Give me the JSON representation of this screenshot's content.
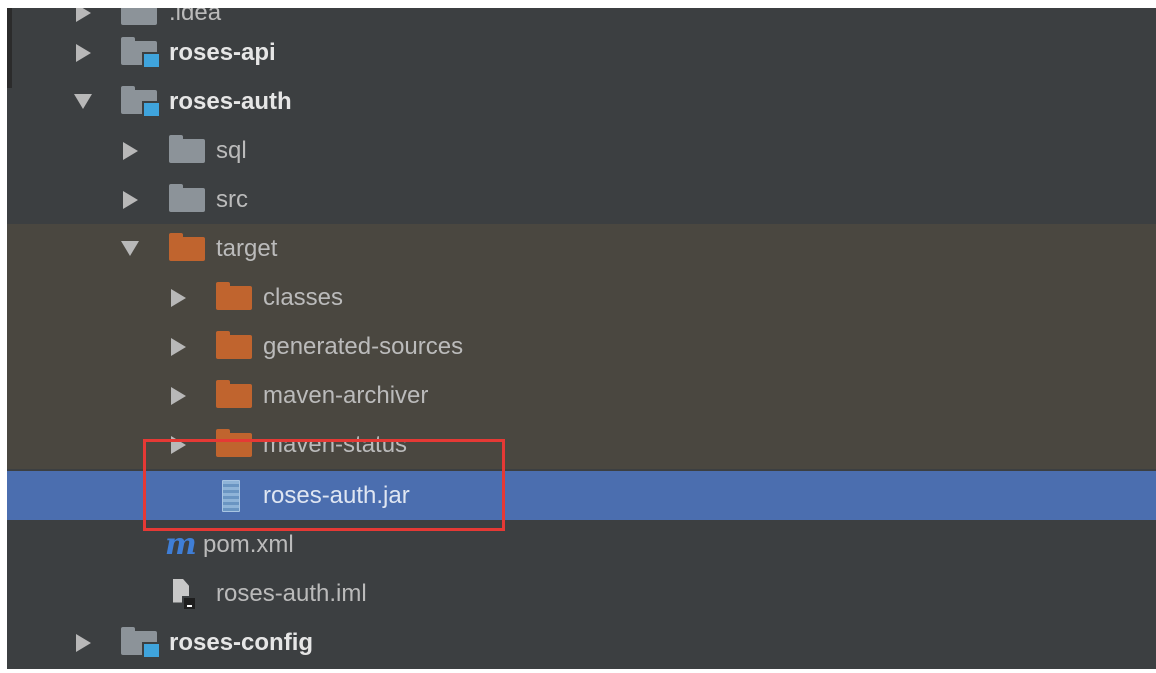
{
  "project_tree": {
    "items": [
      {
        "label": ".idea"
      },
      {
        "label": "roses-api"
      },
      {
        "label": "roses-auth"
      },
      {
        "label": "sql"
      },
      {
        "label": "src"
      },
      {
        "label": "target"
      },
      {
        "label": "classes"
      },
      {
        "label": "generated-sources"
      },
      {
        "label": "maven-archiver"
      },
      {
        "label": "maven-status"
      },
      {
        "label": "roses-auth.jar"
      },
      {
        "label": "pom.xml"
      },
      {
        "label": "roses-auth.iml"
      },
      {
        "label": "roses-config"
      }
    ]
  },
  "colors": {
    "panel_background": "#3c3f41",
    "excluded_background": "#4a4740",
    "selection": "#4b6eaf",
    "annotation": "#e53935"
  }
}
